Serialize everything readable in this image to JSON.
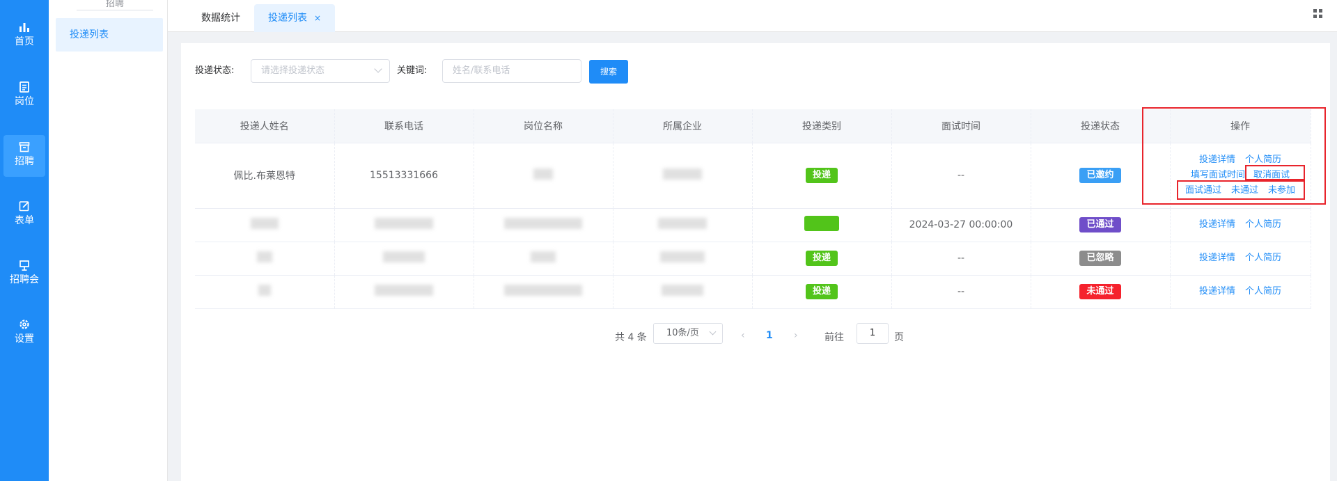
{
  "rail": {
    "items": [
      {
        "label": "首页",
        "icon": "bar-chart-icon"
      },
      {
        "label": "岗位",
        "icon": "document-icon"
      },
      {
        "label": "招聘",
        "icon": "inbox-icon",
        "active": true
      },
      {
        "label": "表单",
        "icon": "edit-icon"
      },
      {
        "label": "招聘会",
        "icon": "presentation-icon"
      },
      {
        "label": "设置",
        "icon": "gear-icon"
      }
    ]
  },
  "submenu": {
    "title": "招聘",
    "active_item": "投递列表"
  },
  "tabs": {
    "items": [
      {
        "label": "数据统计"
      },
      {
        "label": "投递列表",
        "close": "×"
      }
    ]
  },
  "filter": {
    "status_label": "投递状态:",
    "status_placeholder": "请选择投递状态",
    "keyword_label": "关键词:",
    "keyword_placeholder": "姓名/联系电话",
    "search_button": "搜索"
  },
  "table": {
    "headers": [
      "投递人姓名",
      "联系电话",
      "岗位名称",
      "所属企业",
      "投递类别",
      "面试时间",
      "投递状态",
      "操作"
    ],
    "rows": [
      {
        "name": "佩比.布莱恩特",
        "phone": "15513331666",
        "category": "投递",
        "interview_time": "--",
        "status": "已邀约",
        "status_color": "#3a9ff5"
      },
      {
        "name": "",
        "phone": "",
        "category": "",
        "interview_time": "2024-03-27 00:00:00",
        "status": "已通过",
        "status_color": "#6f4ec9"
      },
      {
        "name": "",
        "phone": "",
        "category": "投递",
        "interview_time": "--",
        "status": "已忽略",
        "status_color": "#8c8c8c"
      },
      {
        "name": "",
        "phone": "",
        "category": "投递",
        "interview_time": "--",
        "status": "未通过",
        "status_color": "#f5222d"
      }
    ],
    "actions": {
      "detail": "投递详情",
      "resume": "个人简历",
      "fill_time": "填写面试时间",
      "cancel": "取消面试",
      "pass": "面试通过",
      "fail": "未通过",
      "absent": "未参加"
    }
  },
  "pagination": {
    "total": "共 4 条",
    "page_size": "10条/页",
    "prev": "‹",
    "current": "1",
    "next": "›",
    "goto_label": "前往",
    "goto_value": "1",
    "goto_unit": "页"
  },
  "colors": {
    "brand": "#1f8cf7",
    "annotation": "#e8242c"
  }
}
